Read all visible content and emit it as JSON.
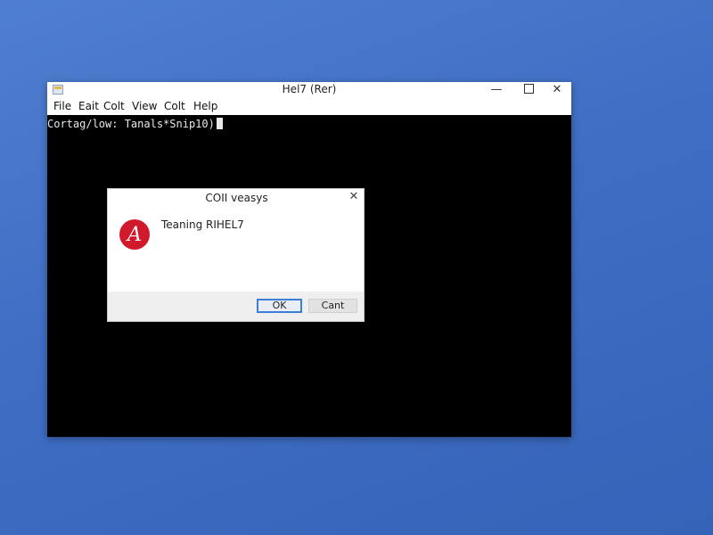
{
  "window": {
    "title": "Hel7 (Rer)",
    "icon": "terminal-app-icon",
    "controls": {
      "minimize": "—",
      "maximize": "",
      "close": "✕"
    }
  },
  "menu": {
    "items": [
      "File",
      "Eait",
      "Colt",
      "View",
      "Colt",
      "Help"
    ]
  },
  "terminal": {
    "line": "Cortag/low: Tanals*Snip10)"
  },
  "dialog": {
    "title": "COII veasys",
    "close": "✕",
    "icon": "error-icon",
    "icon_letter": "A",
    "icon_color": "#d0192b",
    "message": "Teaning RIHEL7",
    "ok_label": "OK",
    "cancel_label": "Cant"
  },
  "colors": {
    "desktop": "#4070c4",
    "terminal_bg": "#000000",
    "accent": "#3d7ed8"
  }
}
